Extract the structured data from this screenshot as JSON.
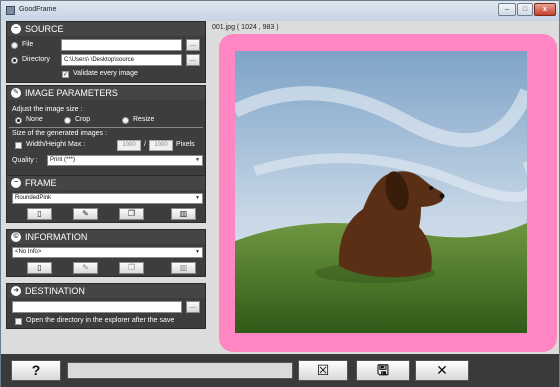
{
  "window": {
    "title": "GoodFrame",
    "buttons": {
      "minimize": "–",
      "maximize": "□",
      "close": "x"
    }
  },
  "source": {
    "title": "SOURCE",
    "file_label": "File",
    "directory_label": "Directory",
    "file_value": "",
    "directory_value": "C:\\Users\\            \\Desktop\\source",
    "browse_label": "...",
    "validate_label": "Validate every image",
    "validate_checked": true,
    "selected_mode": "Directory"
  },
  "image_params": {
    "title": "IMAGE PARAMETERS",
    "adjust_label": "Adjust the image size :",
    "options": [
      "None",
      "Crop",
      "Resize"
    ],
    "selected_option": "None",
    "size_label": "Size of the generated images :",
    "wh_label": "Width/Height Max :",
    "width_value": "1000",
    "slash": "/",
    "height_value": "1000",
    "pixels_label": "Pixels",
    "quality_label": "Quality :",
    "quality_value": "Print (***)"
  },
  "frame": {
    "title": "FRAME",
    "selected": "RoundedPink"
  },
  "information": {
    "title": "INFORMATION",
    "selected": "<No Info>"
  },
  "destination": {
    "title": "DESTINATION",
    "path_value": "",
    "browse_label": "...",
    "open_dir_label": "Open the directory in the explorer after the save"
  },
  "preview": {
    "label": "001.jpg ( 1024 , 983 )",
    "frame_color": "#ff86c2"
  },
  "bottom": {
    "help_label": "?",
    "progress_fraction": 0
  },
  "icons": {
    "new": "new-document-icon",
    "edit": "edit-icon",
    "copy": "copy-icon",
    "delete": "trash-icon",
    "save_disabled": "save-cancel-icon",
    "save": "floppy-disk-icon",
    "close": "close-x-icon"
  }
}
